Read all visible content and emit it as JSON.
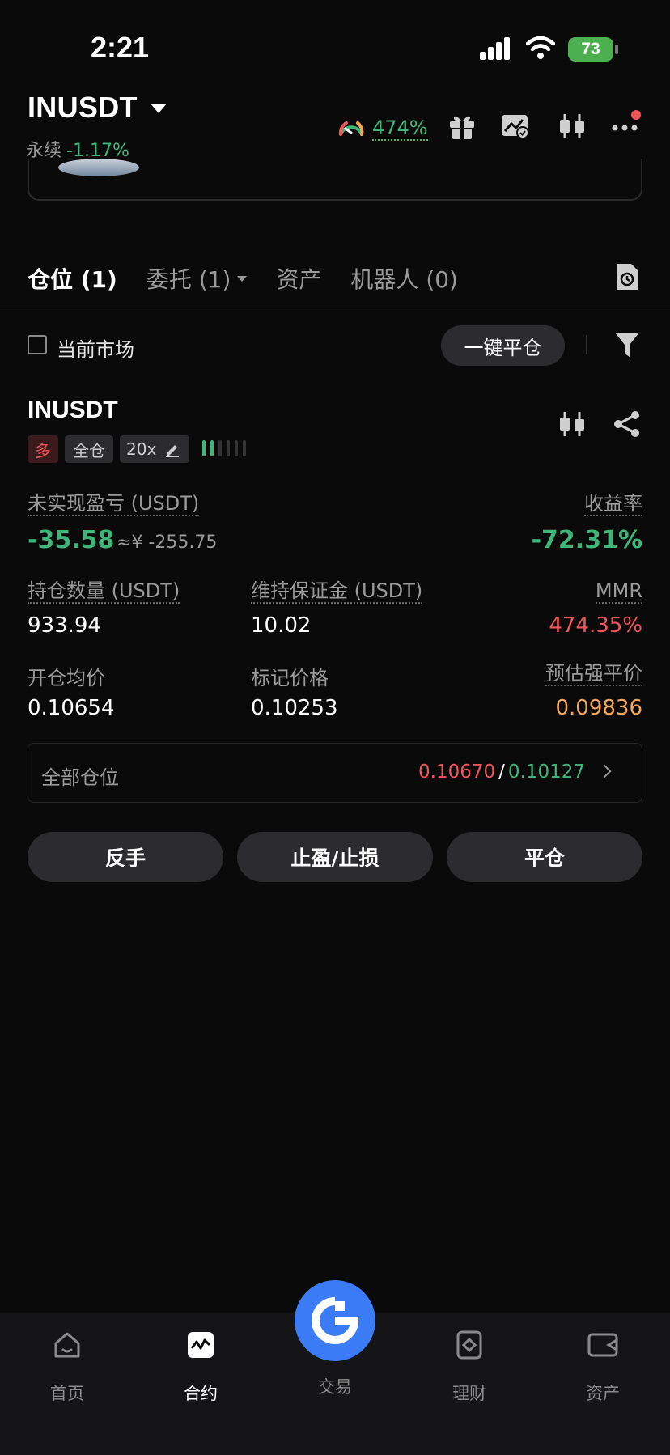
{
  "status_bar": {
    "time": "2:21",
    "battery": "73"
  },
  "header": {
    "pair": "INUSDT",
    "type": "永续",
    "change": "-1.17%",
    "gauge_value": "474%"
  },
  "tabs": [
    {
      "label": "仓位 (1)"
    },
    {
      "label": "委托 (1)"
    },
    {
      "label": "资产"
    },
    {
      "label": "机器人 (0)"
    }
  ],
  "filter": {
    "checkbox_label": "当前市场",
    "close_all": "一键平仓"
  },
  "position": {
    "symbol": "INUSDT",
    "side_tag": "多",
    "margin_tag": "全仓",
    "leverage": "20x",
    "risk_bars": 2,
    "unrealized_label": "未实现盈亏 (USDT)",
    "unrealized_value": "-35.58",
    "unrealized_cny": "≈¥ -255.75",
    "roe_label": "收益率",
    "roe_value": "-72.31%",
    "size_label": "持仓数量 (USDT)",
    "size_value": "933.94",
    "maint_label": "维持保证金 (USDT)",
    "maint_value": "10.02",
    "mmr_label": "MMR",
    "mmr_value": "474.35%",
    "entry_label": "开仓均价",
    "entry_value": "0.10654",
    "mark_label": "标记价格",
    "mark_value": "0.10253",
    "liq_label": "预估强平价",
    "liq_value": "0.09836",
    "all_positions_label": "全部仓位",
    "all_positions_high": "0.10670",
    "all_positions_sep": "/",
    "all_positions_low": "0.10127"
  },
  "actions": {
    "reverse": "反手",
    "tpsl": "止盈/止损",
    "close": "平仓"
  },
  "nav": {
    "home": "首页",
    "futures": "合约",
    "trade": "交易",
    "earn": "理财",
    "assets": "资产"
  },
  "colors": {
    "green": "#3fb57a",
    "red": "#f0555a",
    "orange": "#f5a65b",
    "fab": "#3b7bf6"
  }
}
